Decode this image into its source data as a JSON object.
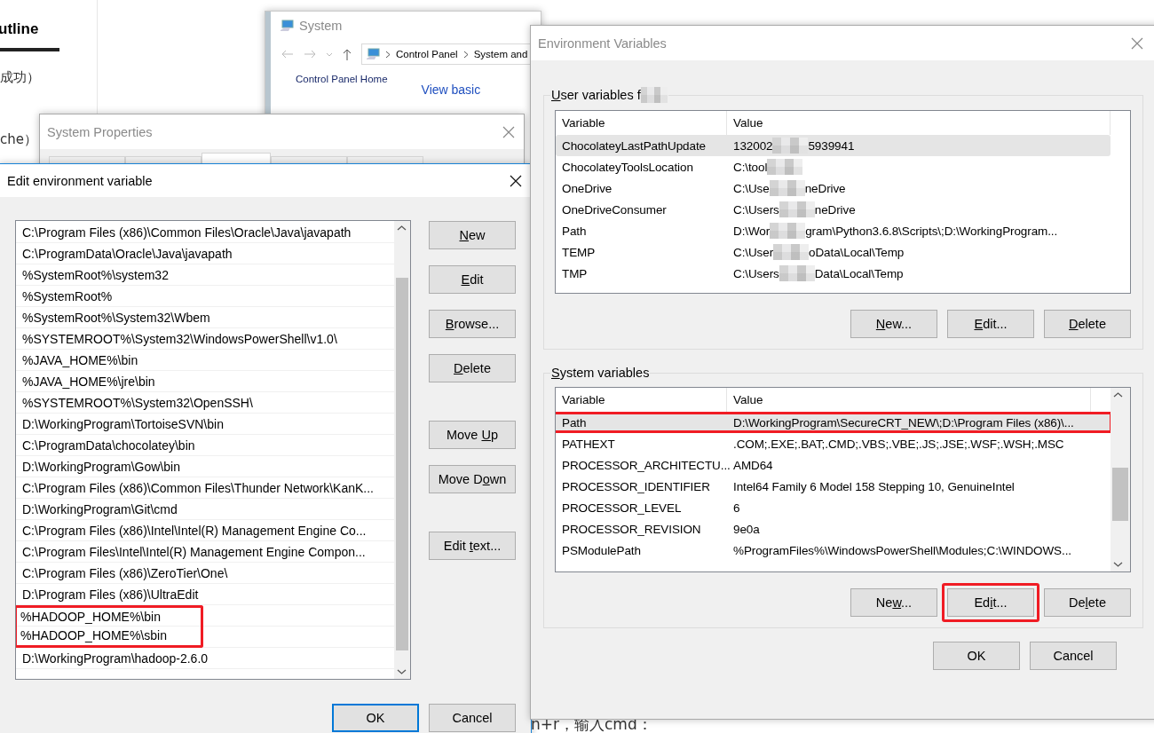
{
  "blog": {
    "heading": "utline",
    "lines": [
      "成功）",
      "che）"
    ],
    "footer": "n+r，输入cmd："
  },
  "system_window": {
    "title": "System",
    "breadcrumb": [
      "Control Panel",
      "System and"
    ],
    "sidebar_link": "Control Panel Home",
    "heading": "View basic"
  },
  "system_properties": {
    "title": "System Properties",
    "tabs": [
      {
        "selected": false
      },
      {
        "selected": false
      },
      {
        "selected": true
      },
      {
        "selected": false
      },
      {
        "selected": false
      }
    ]
  },
  "edit_dialog": {
    "title": "Edit environment variable",
    "entries": [
      {
        "text": "C:\\Program Files (x86)\\Common Files\\Oracle\\Java\\javapath",
        "marked": false
      },
      {
        "text": "C:\\ProgramData\\Oracle\\Java\\javapath",
        "marked": false
      },
      {
        "text": "%SystemRoot%\\system32",
        "marked": false
      },
      {
        "text": "%SystemRoot%",
        "marked": false
      },
      {
        "text": "%SystemRoot%\\System32\\Wbem",
        "marked": false
      },
      {
        "text": "%SYSTEMROOT%\\System32\\WindowsPowerShell\\v1.0\\",
        "marked": false
      },
      {
        "text": "%JAVA_HOME%\\bin",
        "marked": false
      },
      {
        "text": "%JAVA_HOME%\\jre\\bin",
        "marked": false
      },
      {
        "text": "%SYSTEMROOT%\\System32\\OpenSSH\\",
        "marked": false
      },
      {
        "text": "D:\\WorkingProgram\\TortoiseSVN\\bin",
        "marked": false
      },
      {
        "text": "C:\\ProgramData\\chocolatey\\bin",
        "marked": false
      },
      {
        "text": "D:\\WorkingProgram\\Gow\\bin",
        "marked": false
      },
      {
        "text": "C:\\Program Files (x86)\\Common Files\\Thunder Network\\KanK...",
        "marked": false
      },
      {
        "text": "D:\\WorkingProgram\\Git\\cmd",
        "marked": false
      },
      {
        "text": "C:\\Program Files (x86)\\Intel\\Intel(R) Management Engine Co...",
        "marked": false
      },
      {
        "text": "C:\\Program Files\\Intel\\Intel(R) Management Engine Compon...",
        "marked": false
      },
      {
        "text": "C:\\Program Files (x86)\\ZeroTier\\One\\",
        "marked": false
      },
      {
        "text": "D:\\Program Files (x86)\\UltraEdit",
        "marked": false
      },
      {
        "text": "%HADOOP_HOME%\\bin",
        "marked": true
      },
      {
        "text": "%HADOOP_HOME%\\sbin",
        "marked": true
      },
      {
        "text": "D:\\WorkingProgram\\hadoop-2.6.0",
        "marked": false
      }
    ],
    "button_groups": [
      [
        {
          "key": "N",
          "after": "ew"
        },
        {
          "key": "E",
          "after": "dit"
        },
        {
          "key": "B",
          "after": "rowse..."
        },
        {
          "key": "D",
          "after": "elete"
        }
      ],
      [
        {
          "before": "Move ",
          "key": "U",
          "after": "p"
        },
        {
          "before": "Move D",
          "key": "o",
          "after": "wn"
        }
      ],
      [
        {
          "before": "Edit ",
          "key": "t",
          "after": "ext..."
        }
      ]
    ],
    "footer_buttons": [
      {
        "label": "OK",
        "default": true
      },
      {
        "label": "Cancel",
        "default": false
      }
    ]
  },
  "env_dialog": {
    "title": "Environment Variables",
    "groups": [
      {
        "label_key": "U",
        "label_after": "ser variables f",
        "label_redacted": true,
        "columns": [
          "Variable",
          "Value"
        ],
        "scrollbar": false,
        "rows": [
          {
            "name": "ChocolateyLastPathUpdate",
            "value_parts": [
              "132002",
              "5939941"
            ],
            "redacted_end": false,
            "selected": true,
            "marked": false
          },
          {
            "name": "ChocolateyToolsLocation",
            "value_parts": [
              "C:\\tool"
            ],
            "redacted_end": true,
            "selected": false,
            "marked": false
          },
          {
            "name": "OneDrive",
            "value_parts": [
              "C:\\Use",
              "neDrive"
            ],
            "redacted_end": false,
            "selected": false,
            "marked": false
          },
          {
            "name": "OneDriveConsumer",
            "value_parts": [
              "C:\\Users",
              "neDrive"
            ],
            "redacted_end": false,
            "selected": false,
            "marked": false
          },
          {
            "name": "Path",
            "value_parts": [
              "D:\\Wor",
              "gram\\Python3.6.8\\Scripts\\;D:\\WorkingProgram..."
            ],
            "redacted_end": false,
            "selected": false,
            "marked": false
          },
          {
            "name": "TEMP",
            "value_parts": [
              "C:\\User",
              "oData\\Local\\Temp"
            ],
            "redacted_end": false,
            "selected": false,
            "marked": false
          },
          {
            "name": "TMP",
            "value_parts": [
              "C:\\Users",
              "Data\\Local\\Temp"
            ],
            "redacted_end": false,
            "selected": false,
            "marked": false
          }
        ],
        "buttons": [
          {
            "key": "N",
            "after": "ew...",
            "marked": false
          },
          {
            "key": "E",
            "after": "dit...",
            "marked": false
          },
          {
            "key": "D",
            "after": "elete",
            "marked": false
          }
        ]
      },
      {
        "label_key": "S",
        "label_after": "ystem variables",
        "label_redacted": false,
        "columns": [
          "Variable",
          "Value"
        ],
        "scrollbar": true,
        "rows": [
          {
            "name": "Path",
            "value_parts": [
              "D:\\WorkingProgram\\SecureCRT_NEW\\;D:\\Program Files (x86)\\..."
            ],
            "redacted_end": false,
            "selected": true,
            "marked": true
          },
          {
            "name": "PATHEXT",
            "value_parts": [
              ".COM;.EXE;.BAT;.CMD;.VBS;.VBE;.JS;.JSE;.WSF;.WSH;.MSC"
            ],
            "redacted_end": false,
            "selected": false,
            "marked": false
          },
          {
            "name": "PROCESSOR_ARCHITECTU...",
            "value_parts": [
              "AMD64"
            ],
            "redacted_end": false,
            "selected": false,
            "marked": false
          },
          {
            "name": "PROCESSOR_IDENTIFIER",
            "value_parts": [
              "Intel64 Family 6 Model 158 Stepping 10, GenuineIntel"
            ],
            "redacted_end": false,
            "selected": false,
            "marked": false
          },
          {
            "name": "PROCESSOR_LEVEL",
            "value_parts": [
              "6"
            ],
            "redacted_end": false,
            "selected": false,
            "marked": false
          },
          {
            "name": "PROCESSOR_REVISION",
            "value_parts": [
              "9e0a"
            ],
            "redacted_end": false,
            "selected": false,
            "marked": false
          },
          {
            "name": "PSModulePath",
            "value_parts": [
              "%ProgramFiles%\\WindowsPowerShell\\Modules;C:\\WINDOWS..."
            ],
            "redacted_end": false,
            "selected": false,
            "marked": false
          }
        ],
        "buttons": [
          {
            "before": "Ne",
            "key": "w",
            "after": "...",
            "marked": false
          },
          {
            "before": "Ed",
            "key": "i",
            "after": "t...",
            "marked": true
          },
          {
            "before": "De",
            "key": "l",
            "after": "ete",
            "marked": false
          }
        ]
      }
    ],
    "footer_buttons": [
      {
        "label": "OK",
        "default": false
      },
      {
        "label": "Cancel",
        "default": false
      }
    ]
  }
}
